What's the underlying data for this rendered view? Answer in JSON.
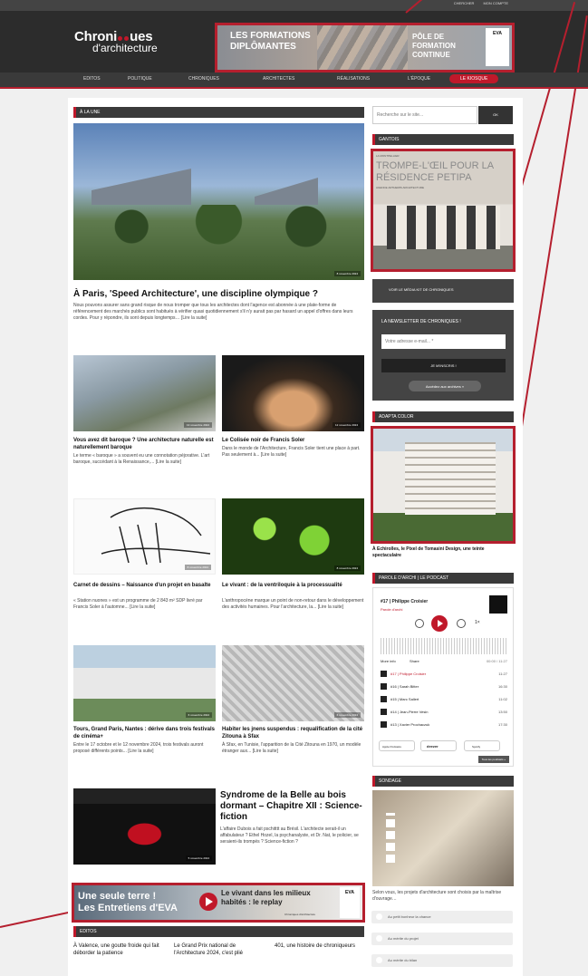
{
  "top_links": [
    "CHERCHER",
    "MON COMPTE"
  ],
  "logo": {
    "line1a": "Chroni",
    "line1b": "ues",
    "line2": "d'architecture"
  },
  "banner": {
    "left": "LES FORMATIONS DIPLÔMANTES",
    "right": "PÔLE DE FORMATION CONTINUE",
    "eva": "EVA"
  },
  "nav": [
    "EDITOS",
    "POLITIQUE",
    "CHRONIQUES",
    "ARCHITECTES",
    "RÉALISATIONS",
    "L'ÉPOQUE",
    "LE KIOSQUE"
  ],
  "a_la_une": {
    "header": "À LA UNE",
    "stamp": "8 novembre 2024",
    "title": "À Paris, 'Speed Architecture', une discipline olympique ?",
    "text": "Nous pouvons assurer sans grand risque de nous tromper que tous les architectes dont l'agence est abonnée à une plate-forme de référencement des marchés publics sont habitués à vérifier quasi quotidiennement s'il n'y aurait pas par hasard un appel d'offres dans leurs cordes. Pour y répondre, ils sont depuis longtemps… [Lire la suite]"
  },
  "articles": [
    {
      "title": "Vous avez dit baroque ? Une architecture naturelle est naturellement baroque",
      "text": "Le terme « baroque » a souvent eu une connotation péjorative. L'art baroque, succédant à la Renaissance,... [Lire la suite]",
      "stamp": "13 novembre 2024"
    },
    {
      "title": "Le Colisée noir de Francis Soler",
      "text": "Dans le monde de l'Architecture, Francis Soler tient une place à part. Pas seulement à... [Lire la suite]",
      "stamp": "12 novembre 2024"
    },
    {
      "title": "Carnet de dessins – Naissance d'un projet en basalte",
      "text": "« Station nuones » est un programme de 2 843 m² SDP livré par Francis Soler à l'automne... [Lire la suite]",
      "stamp": "8 novembre 2024"
    },
    {
      "title": "Le vivant : de la ventriloquie à la processualité",
      "text": "L'anthropocène marque un point de non-retour dans le développement des activités humaines. Pour l'architecture, la... [Lire la suite]",
      "stamp": "8 novembre 2024"
    },
    {
      "title": "Tours, Grand Paris, Nantes : dérive dans trois festivals de cinéma+",
      "text": "Entre le 17 octobre et le 12 novembre 2024, trois festivals auront proposé différents points... [Lire la suite]",
      "stamp": "6 novembre 2024"
    },
    {
      "title": "Habiter les jnens suspendus : requalification de la cité Zitouna à Sfax",
      "text": "À Sfax, en Tunisie, l'apparition de la Cité Zitouna en 1970, un modèle étranger aux... [Lire la suite]",
      "stamp": "6 novembre 2024"
    }
  ],
  "syndrome": {
    "title": "Syndrome de la Belle au bois dormant – Chapitre XII : Science-fiction",
    "text": "L'affaire Dubois a fait pschitttt au Brésil. L'architecte serait-il un affabulateur ? Ethel Hozel, la psychanalyste, et Dr. Nat, le policier, se seraient-ils trompés ? Science-fiction ?",
    "stamp": "5 novembre 2024"
  },
  "bottom_banner": {
    "left1": "Une seule terre !",
    "left2": "Les Entretiens d'EVA",
    "right": "Le vivant dans les milieux habités : le replay",
    "sub": "Chroniques d'architecture"
  },
  "editos": {
    "header": "EDITOS",
    "items": [
      "À Valence, une goutte froide qui fait déborder la patience",
      "Le Grand Prix national de l'Architecture 2024, c'est plié",
      "401, une histoire de chroniqueurs"
    ]
  },
  "sidebar": {
    "search_placeholder": "Recherche sur le site...",
    "search_button": "OK",
    "gantois": "GANTOIS",
    "ad1": {
      "kicker": "LA MONTPELLIER",
      "title": "TROMPE-L'ŒIL POUR LA RÉSIDENCE PETIPA",
      "sub": "AGENCE ARTHEMIS ARCHITECTURE"
    },
    "media_kit": "VOIR LE MÉDIA KIT DE CHRONIQUES",
    "newsletter": {
      "title": "LA NEWSLETTER DE CHRONIQUES !",
      "placeholder": "Votre adresse e-mail... *",
      "subscribe": "JE M'INSCRIS !",
      "archives": "Accédez aux archives »"
    },
    "adapta": "ADAPTA COLOR",
    "adapta_caption": "À Echirolles, le Pixel de Tomasini Design, une teinte spectaculaire",
    "podcast": {
      "header": "PAROLE D'ARCHI | LE PODCAST",
      "episode": "#17 | Philippe Croisier",
      "show": "Parole d'archi",
      "more": "More info",
      "share": "Share",
      "time": "00:00 / 11:27",
      "speed": "1×",
      "tracks": [
        {
          "n": "#17 | Philippe Croisier",
          "t": "11:27"
        },
        {
          "n": "#16 | Sarah Bitter",
          "t": "16:30"
        },
        {
          "n": "#15 | Marc Sallert",
          "t": "11:02"
        },
        {
          "n": "#14 | Jean-Pierre Vesin",
          "t": "13:50"
        },
        {
          "n": "#13 | Xavier Prochaczuk",
          "t": "17:30"
        }
      ],
      "platforms": [
        "Apple Podcasts",
        "deezer",
        "Spotify"
      ],
      "all": "Tous les podcasts »"
    },
    "sondage": "SONDAGE",
    "poll_text": "Selon vous, les projets d'architecture sont choisis par la maîtrise d'ouvrage…",
    "poll_options": [
      "Au petit bonheur la chance",
      "Au mérite du projet",
      "Au mérite du bilan"
    ]
  },
  "colors": {
    "accent": "#c0182a",
    "dark": "#2c2c2c"
  }
}
